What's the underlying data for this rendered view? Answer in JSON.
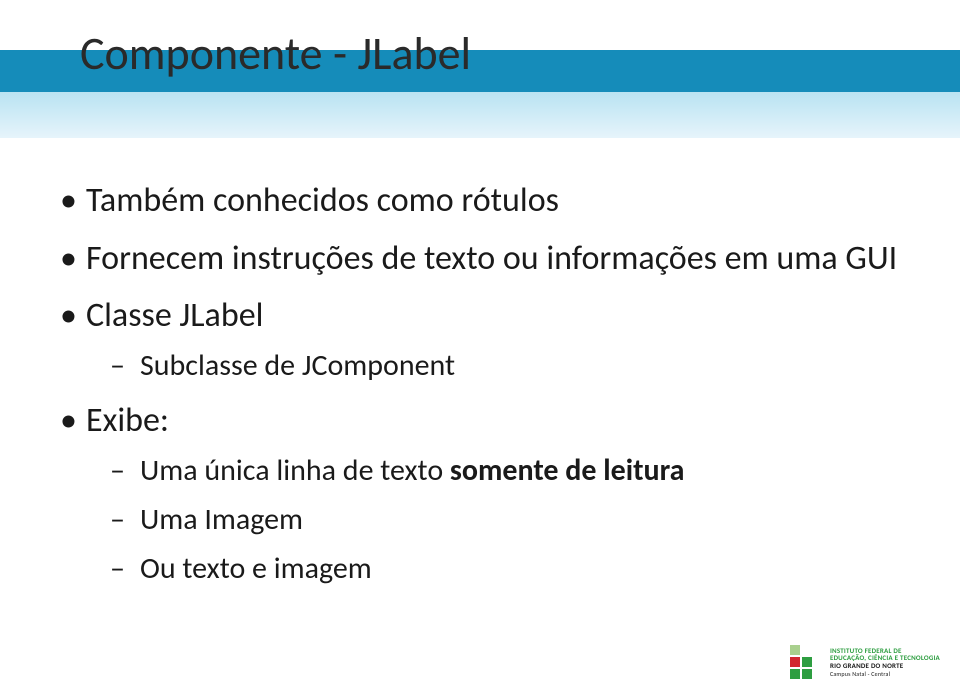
{
  "title": "Componente - JLabel",
  "bullets": {
    "b1": "Também conhecidos como rótulos",
    "b2": "Fornecem instruções de texto ou informações em uma GUI",
    "b3": "Classe JLabel",
    "b3_sub1": "Subclasse de JComponent",
    "b4": "Exibe:",
    "b4_sub1_pre": "Uma única linha de texto ",
    "b4_sub1_bold": "somente de leitura",
    "b4_sub2": "Uma Imagem",
    "b4_sub3": "Ou texto e imagem"
  },
  "footer": {
    "line1": "INSTITUTO FEDERAL DE",
    "line2": "EDUCAÇÃO, CIÊNCIA E TECNOLOGIA",
    "line3": "RIO GRANDE DO NORTE",
    "campus": "Campus Natal - Central"
  }
}
